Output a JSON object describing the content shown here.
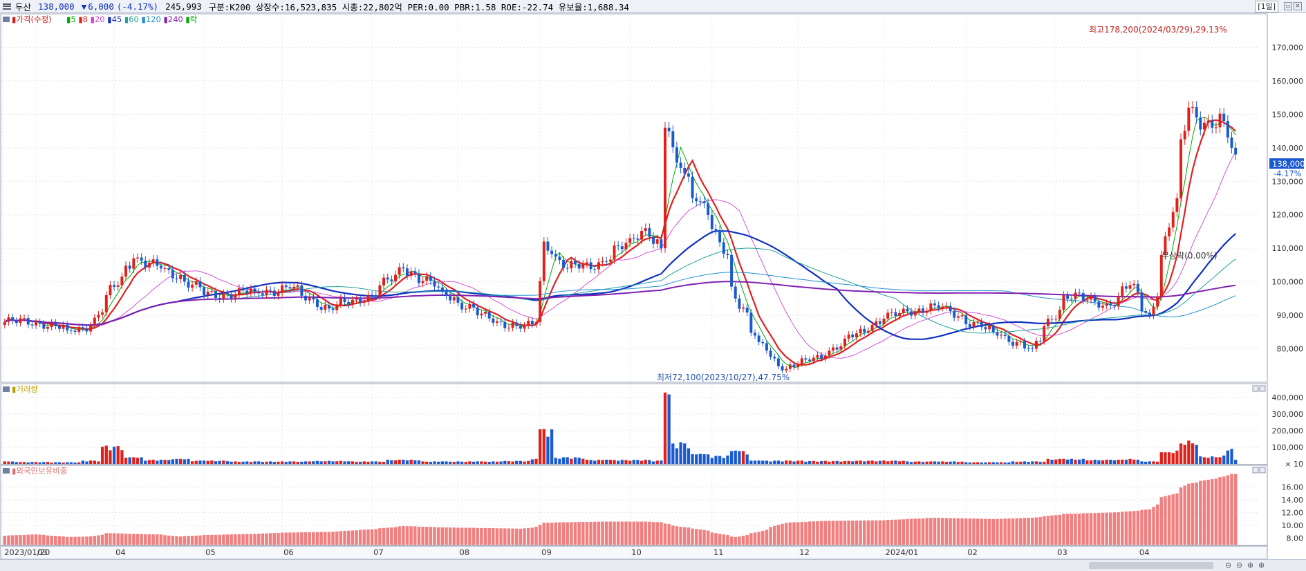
{
  "header": {
    "name": "두산",
    "price": "138,000",
    "change_arrow": "▼",
    "change": "6,000",
    "change_pct": "(-4.17%)",
    "volume": "245,993",
    "fields": "구분:K200 상장수:16,523,835 시총:22,802억 PER:0.00 PBR:1.58 ROE:-22.74 유보율:1,688.34",
    "period": "[1일]"
  },
  "legend": {
    "price_label": "가격(수정)",
    "ma": [
      {
        "label": "5",
        "color": "#00aa00"
      },
      {
        "label": "8",
        "color": "#e02020"
      },
      {
        "label": "20",
        "color": "#d040d0"
      },
      {
        "label": "45",
        "color": "#1030c0"
      },
      {
        "label": "60",
        "color": "#20a0a0"
      },
      {
        "label": "120",
        "color": "#2090d0"
      },
      {
        "label": "240",
        "color": "#8020b0"
      }
    ],
    "lock_label": "락"
  },
  "volume_pane": {
    "title": "거래량",
    "unit": "× 10"
  },
  "foreign_pane": {
    "title": "외국인보유비중"
  },
  "annotations": {
    "high": "최고178,200(2024/03/29),29.13%",
    "low": "최저72,100(2023/10/27),47.75%",
    "lock": "무상락(0.00%)",
    "price_tag": "138,000",
    "pct_tag": "-4.17%"
  },
  "axes": {
    "price_ticks": [
      "80,000",
      "90,000",
      "100,000",
      "110,000",
      "120,000",
      "130,000",
      "140,000",
      "150,000",
      "160,000",
      "170,000"
    ],
    "volume_ticks": [
      "100,000",
      "200,000",
      "300,000",
      "400,000"
    ],
    "foreign_ticks": [
      "8.00",
      "10.00",
      "12.00",
      "14.00",
      "16.00"
    ],
    "date_labels": [
      "2023/01/20",
      "03",
      "04",
      "05",
      "06",
      "07",
      "08",
      "09",
      "10",
      "11",
      "12",
      "2024/01",
      "02",
      "03",
      "04"
    ]
  },
  "colors": {
    "up": "#e0201a",
    "down": "#1a5ad0",
    "foreign_bar": "#f08080"
  },
  "chart_data": {
    "type": "candlestick",
    "price_ylim": [
      70000,
      180000
    ],
    "volume_ylim": [
      0,
      450000
    ],
    "foreign_ylim": [
      7,
      18.5
    ],
    "keyframes": [
      {
        "d": "2023-01-20",
        "c": 88000,
        "v": 15000,
        "f": 8.4
      },
      {
        "d": "2023-02-01",
        "c": 88000,
        "v": 12000,
        "f": 8.6
      },
      {
        "d": "2023-02-13",
        "c": 85500,
        "v": 10000,
        "f": 8.2
      },
      {
        "d": "2023-02-21",
        "c": 87000,
        "v": 20000,
        "f": 8.3
      },
      {
        "d": "2023-02-27",
        "c": 96000,
        "v": 110000,
        "f": 8.8
      },
      {
        "d": "2023-03-08",
        "c": 107000,
        "v": 40000,
        "f": 8.7
      },
      {
        "d": "2023-03-17",
        "c": 104000,
        "v": 25000,
        "f": 8.6
      },
      {
        "d": "2023-03-24",
        "c": 102000,
        "v": 30000,
        "f": 8.3
      },
      {
        "d": "2023-04-03",
        "c": 96000,
        "v": 20000,
        "f": 8.5
      },
      {
        "d": "2023-04-20",
        "c": 97000,
        "v": 15000,
        "f": 8.7
      },
      {
        "d": "2023-05-03",
        "c": 98000,
        "v": 15000,
        "f": 8.9
      },
      {
        "d": "2023-05-17",
        "c": 92000,
        "v": 18000,
        "f": 9.0
      },
      {
        "d": "2023-06-01",
        "c": 96000,
        "v": 15000,
        "f": 9.4
      },
      {
        "d": "2023-06-13",
        "c": 104000,
        "v": 25000,
        "f": 9.9
      },
      {
        "d": "2023-06-27",
        "c": 97000,
        "v": 15000,
        "f": 9.7
      },
      {
        "d": "2023-07-10",
        "c": 90000,
        "v": 15000,
        "f": 9.6
      },
      {
        "d": "2023-07-25",
        "c": 86000,
        "v": 18000,
        "f": 9.5
      },
      {
        "d": "2023-07-31",
        "c": 88000,
        "v": 30000,
        "f": 9.8
      },
      {
        "d": "2023-08-02",
        "c": 112000,
        "v": 210000,
        "f": 10.4
      },
      {
        "d": "2023-08-10",
        "c": 104000,
        "v": 40000,
        "f": 10.5
      },
      {
        "d": "2023-08-24",
        "c": 106000,
        "v": 25000,
        "f": 10.6
      },
      {
        "d": "2023-09-07",
        "c": 116000,
        "v": 25000,
        "f": 10.6
      },
      {
        "d": "2023-09-13",
        "c": 110000,
        "v": 20000,
        "f": 10.5
      },
      {
        "d": "2023-09-14",
        "c": 146000,
        "v": 430000,
        "f": 10.3
      },
      {
        "d": "2023-09-20",
        "c": 134000,
        "v": 130000,
        "f": 9.8
      },
      {
        "d": "2023-09-27",
        "c": 124000,
        "v": 60000,
        "f": 9.4
      },
      {
        "d": "2023-10-06",
        "c": 108000,
        "v": 50000,
        "f": 8.5
      },
      {
        "d": "2023-10-10",
        "c": 95000,
        "v": 80000,
        "f": 8.2
      },
      {
        "d": "2023-10-18",
        "c": 82000,
        "v": 20000,
        "f": 9.0
      },
      {
        "d": "2023-10-27",
        "c": 74000,
        "v": 20000,
        "f": 10.4
      },
      {
        "d": "2023-11-10",
        "c": 78000,
        "v": 18000,
        "f": 10.7
      },
      {
        "d": "2023-12-01",
        "c": 89000,
        "v": 20000,
        "f": 10.8
      },
      {
        "d": "2023-12-20",
        "c": 93000,
        "v": 15000,
        "f": 11.2
      },
      {
        "d": "2024-01-10",
        "c": 85000,
        "v": 10000,
        "f": 11.0
      },
      {
        "d": "2024-01-24",
        "c": 80000,
        "v": 15000,
        "f": 11.2
      },
      {
        "d": "2024-02-05",
        "c": 96000,
        "v": 30000,
        "f": 11.8
      },
      {
        "d": "2024-02-21",
        "c": 93000,
        "v": 25000,
        "f": 12.0
      },
      {
        "d": "2024-02-28",
        "c": 99000,
        "v": 30000,
        "f": 12.2
      },
      {
        "d": "2024-03-06",
        "c": 90000,
        "v": 15000,
        "f": 12.5
      },
      {
        "d": "2024-03-11",
        "c": 108000,
        "v": 70000,
        "f": 14.4
      },
      {
        "d": "2024-03-15",
        "c": 125000,
        "v": 80000,
        "f": 15.0
      },
      {
        "d": "2024-03-20",
        "c": 152000,
        "v": 140000,
        "f": 16.5
      },
      {
        "d": "2024-03-28",
        "c": 146000,
        "v": 45000,
        "f": 17.2
      },
      {
        "d": "2024-04-02",
        "c": 148000,
        "v": 50000,
        "f": 17.6
      },
      {
        "d": "2024-04-04",
        "c": 140000,
        "v": 90000,
        "f": 18.0
      },
      {
        "d": "2024-04-05",
        "c": 138000,
        "v": 24600,
        "f": 18.0
      }
    ]
  }
}
